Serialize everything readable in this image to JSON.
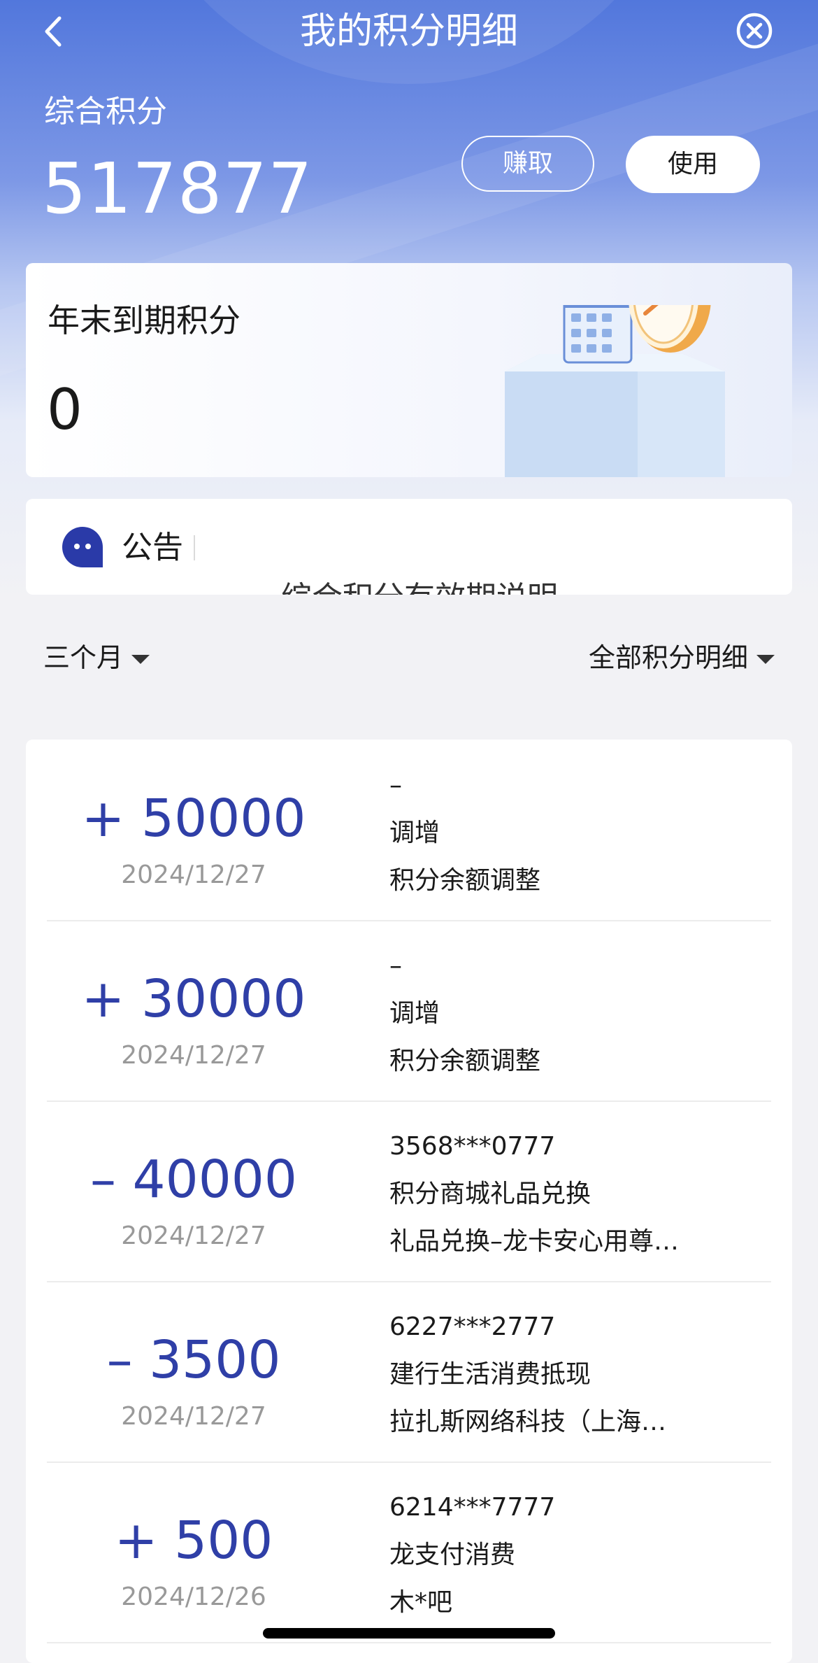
{
  "nav": {
    "title": "我的积分明细",
    "back_icon": "chevron-left-icon",
    "close_icon": "close-circle-icon"
  },
  "summary": {
    "label": "综合积分",
    "value": "517877",
    "earn_label": "赚取",
    "use_label": "使用"
  },
  "expiring": {
    "label": "年末到期积分",
    "value": "0",
    "illustration": "calendar-clock-icon"
  },
  "notice": {
    "label": "公告",
    "scroll_text": "综合积分有效期说明"
  },
  "filters": {
    "period": "三个月",
    "type": "全部积分明细"
  },
  "transactions": [
    {
      "amount": "+ 50000",
      "date": "2024/12/27",
      "line1": "–",
      "line2": "调增",
      "line3": "积分余额调整"
    },
    {
      "amount": "+ 30000",
      "date": "2024/12/27",
      "line1": "–",
      "line2": "调增",
      "line3": "积分余额调整"
    },
    {
      "amount": "– 40000",
      "date": "2024/12/27",
      "line1": "3568***0777",
      "line2": "积分商城礼品兑换",
      "line3": "礼品兑换–龙卡安心用尊…"
    },
    {
      "amount": "– 3500",
      "date": "2024/12/27",
      "line1": "6227***2777",
      "line2": "建行生活消费抵现",
      "line3": "拉扎斯网络科技（上海…"
    },
    {
      "amount": "+ 500",
      "date": "2024/12/26",
      "line1": "6214***7777",
      "line2": "龙支付消费",
      "line3": "木*吧"
    }
  ],
  "colors": {
    "header_blue": "#5277dc",
    "amount_blue": "#2f3fa7",
    "date_gray": "#999999"
  }
}
